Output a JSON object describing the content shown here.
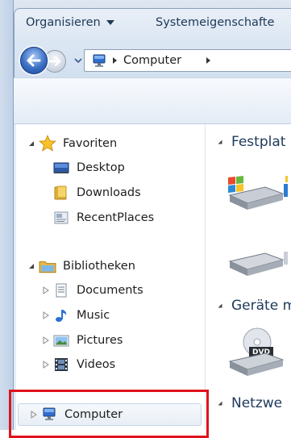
{
  "address_bar": {
    "crumbs": [
      "Computer"
    ]
  },
  "toolbar": {
    "organize": "Organisieren",
    "system_properties": "Systemeigenschafte"
  },
  "nav_tree": {
    "favorites": {
      "label": "Favoriten",
      "items": [
        {
          "label": "Desktop"
        },
        {
          "label": "Downloads"
        },
        {
          "label": "RecentPlaces"
        }
      ]
    },
    "libraries": {
      "label": "Bibliotheken",
      "items": [
        {
          "label": "Documents"
        },
        {
          "label": "Music"
        },
        {
          "label": "Pictures"
        },
        {
          "label": "Videos"
        }
      ]
    },
    "computer": {
      "label": "Computer"
    }
  },
  "content": {
    "groups": [
      {
        "label": "Festplat"
      },
      {
        "label": "Geräte m"
      },
      {
        "label": "Netzwe"
      }
    ]
  },
  "colors": {
    "highlight": "#e0121b",
    "accent": "#1e395b"
  }
}
